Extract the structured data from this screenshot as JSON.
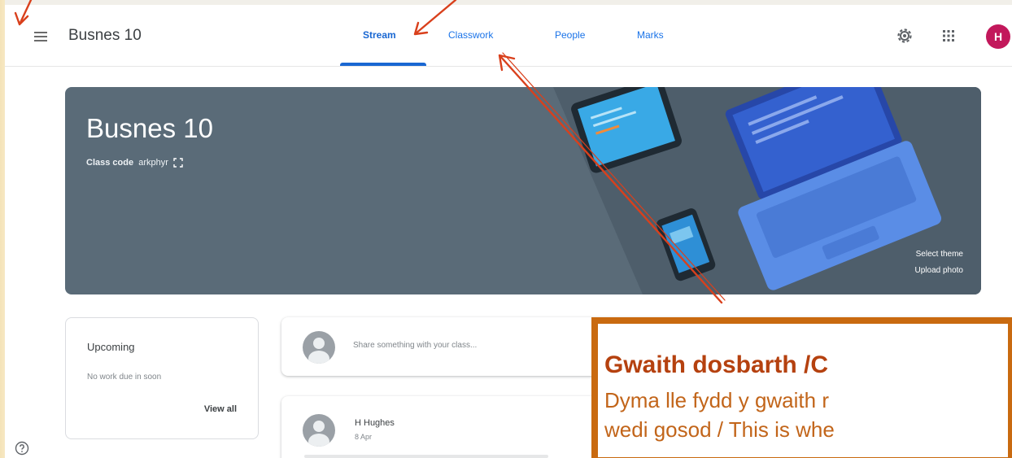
{
  "header": {
    "class_name": "Busnes 10",
    "tabs": [
      {
        "label": "Stream",
        "active": true
      },
      {
        "label": "Classwork",
        "active": false
      },
      {
        "label": "People",
        "active": false
      },
      {
        "label": "Marks",
        "active": false
      }
    ],
    "avatar_initial": "H"
  },
  "banner": {
    "title": "Busnes 10",
    "class_code_label": "Class code",
    "class_code_value": "arkphyr",
    "select_theme": "Select theme",
    "upload_photo": "Upload photo",
    "color": "#5a6b78"
  },
  "upcoming": {
    "title": "Upcoming",
    "text": "No work due in soon",
    "view_all": "View all"
  },
  "stream": {
    "share_placeholder": "Share something with your class...",
    "posts": [
      {
        "author": "H Hughes",
        "date": "8 Apr"
      }
    ]
  },
  "annotation": {
    "title": "Gwaith dosbarth /C",
    "body_line1": "Dyma lle fydd y gwaith r",
    "body_line2": "wedi gosod / This is whe",
    "border_color": "#c96a10",
    "arrow_color": "#d9401c"
  },
  "icons": [
    "menu-icon",
    "gear-icon",
    "apps-icon",
    "help-icon",
    "fullscreen-icon"
  ],
  "colors": {
    "accent": "#1967d2",
    "avatar": "#c2185b"
  }
}
